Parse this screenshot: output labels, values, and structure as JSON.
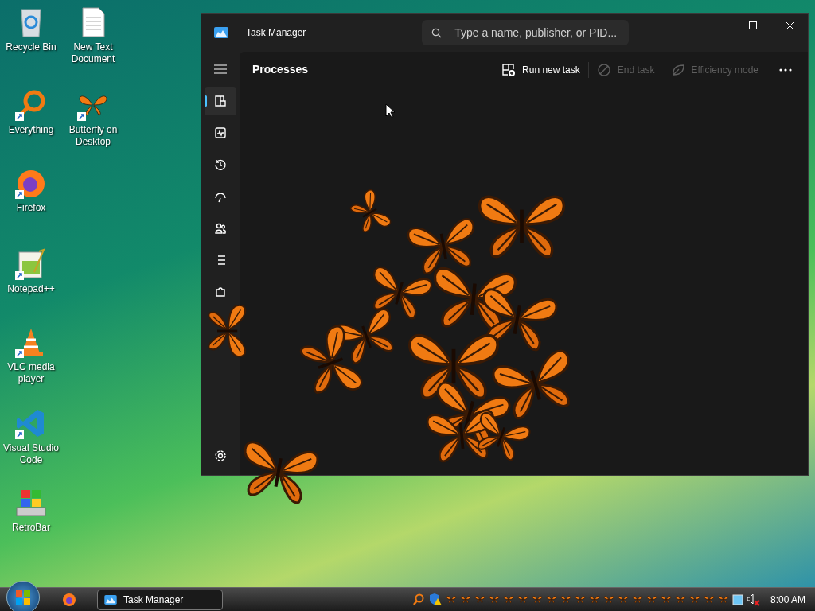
{
  "desktop_icons": [
    {
      "kind": "recycle",
      "label": "Recycle Bin",
      "shortcut": false
    },
    {
      "kind": "text",
      "label": "New Text Document",
      "shortcut": false
    },
    {
      "kind": "everything",
      "label": "Everything",
      "shortcut": true
    },
    {
      "kind": "butterfly",
      "label": "Butterfly on Desktop",
      "shortcut": true
    },
    {
      "kind": "firefox",
      "label": "Firefox",
      "shortcut": true
    },
    {
      "kind": "notepad",
      "label": "Notepad++",
      "shortcut": true
    },
    {
      "kind": "vlc",
      "label": "VLC media player",
      "shortcut": true
    },
    {
      "kind": "vscode",
      "label": "Visual Studio Code",
      "shortcut": true
    },
    {
      "kind": "retrobar",
      "label": "RetroBar",
      "shortcut": false
    }
  ],
  "window": {
    "title": "Task Manager",
    "search": {
      "placeholder": "Type a name, publisher, or PID..."
    },
    "nav": [
      {
        "kind": "processes",
        "selected": true
      },
      {
        "kind": "performance",
        "selected": false
      },
      {
        "kind": "history",
        "selected": false
      },
      {
        "kind": "startup",
        "selected": false
      },
      {
        "kind": "users",
        "selected": false
      },
      {
        "kind": "details",
        "selected": false
      },
      {
        "kind": "services",
        "selected": false
      }
    ],
    "page_title": "Processes",
    "toolbar": [
      {
        "kind": "run",
        "label": "Run new task",
        "disabled": false
      },
      {
        "kind": "end",
        "label": "End task",
        "disabled": true
      },
      {
        "kind": "efficiency",
        "label": "Efficiency mode",
        "disabled": true
      }
    ]
  },
  "taskbar": {
    "tasks": [
      {
        "label": "Task Manager",
        "selected": true
      }
    ],
    "tray": [
      {
        "kind": "search"
      },
      {
        "kind": "shield"
      },
      {
        "kind": "butterfly"
      },
      {
        "kind": "butterfly"
      },
      {
        "kind": "butterfly"
      },
      {
        "kind": "butterfly"
      },
      {
        "kind": "butterfly"
      },
      {
        "kind": "butterfly"
      },
      {
        "kind": "butterfly"
      },
      {
        "kind": "butterfly"
      },
      {
        "kind": "butterfly"
      },
      {
        "kind": "butterfly"
      },
      {
        "kind": "butterfly"
      },
      {
        "kind": "butterfly"
      },
      {
        "kind": "butterfly"
      },
      {
        "kind": "butterfly"
      },
      {
        "kind": "butterfly"
      },
      {
        "kind": "butterfly"
      },
      {
        "kind": "butterfly"
      },
      {
        "kind": "butterfly"
      },
      {
        "kind": "butterfly"
      },
      {
        "kind": "butterfly"
      },
      {
        "kind": "window"
      },
      {
        "kind": "volume-muted"
      }
    ],
    "clock": "8:00 AM"
  }
}
